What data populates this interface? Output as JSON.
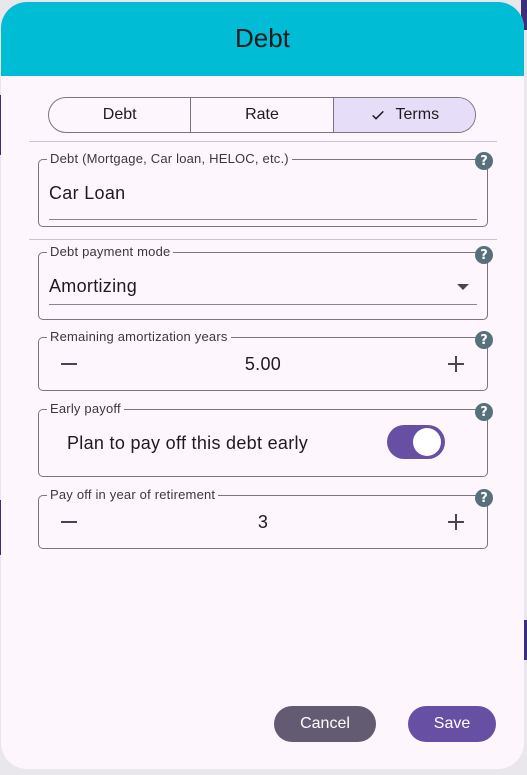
{
  "dialog": {
    "title": "Debt",
    "tabs": [
      {
        "label": "Debt",
        "selected": false
      },
      {
        "label": "Rate",
        "selected": false
      },
      {
        "label": "Terms",
        "selected": true
      }
    ],
    "debt_name": {
      "label": "Debt (Mortgage, Car loan, HELOC, etc.)",
      "value": "Car Loan"
    },
    "payment_mode": {
      "label": "Debt payment mode",
      "value": "Amortizing"
    },
    "amortization_years": {
      "label": "Remaining amortization years",
      "value": "5.00"
    },
    "early_payoff": {
      "label": "Early payoff",
      "text": "Plan to pay off this debt early",
      "enabled": true
    },
    "payoff_year": {
      "label": "Pay off in year of retirement",
      "value": "3"
    },
    "help_glyph": "?",
    "cancel_label": "Cancel",
    "save_label": "Save"
  },
  "colors": {
    "header": "#00bcd4",
    "accent": "#6750a4",
    "secondary": "#625b71",
    "selected_tab": "#e6def8",
    "help_icon": "#58707c"
  }
}
